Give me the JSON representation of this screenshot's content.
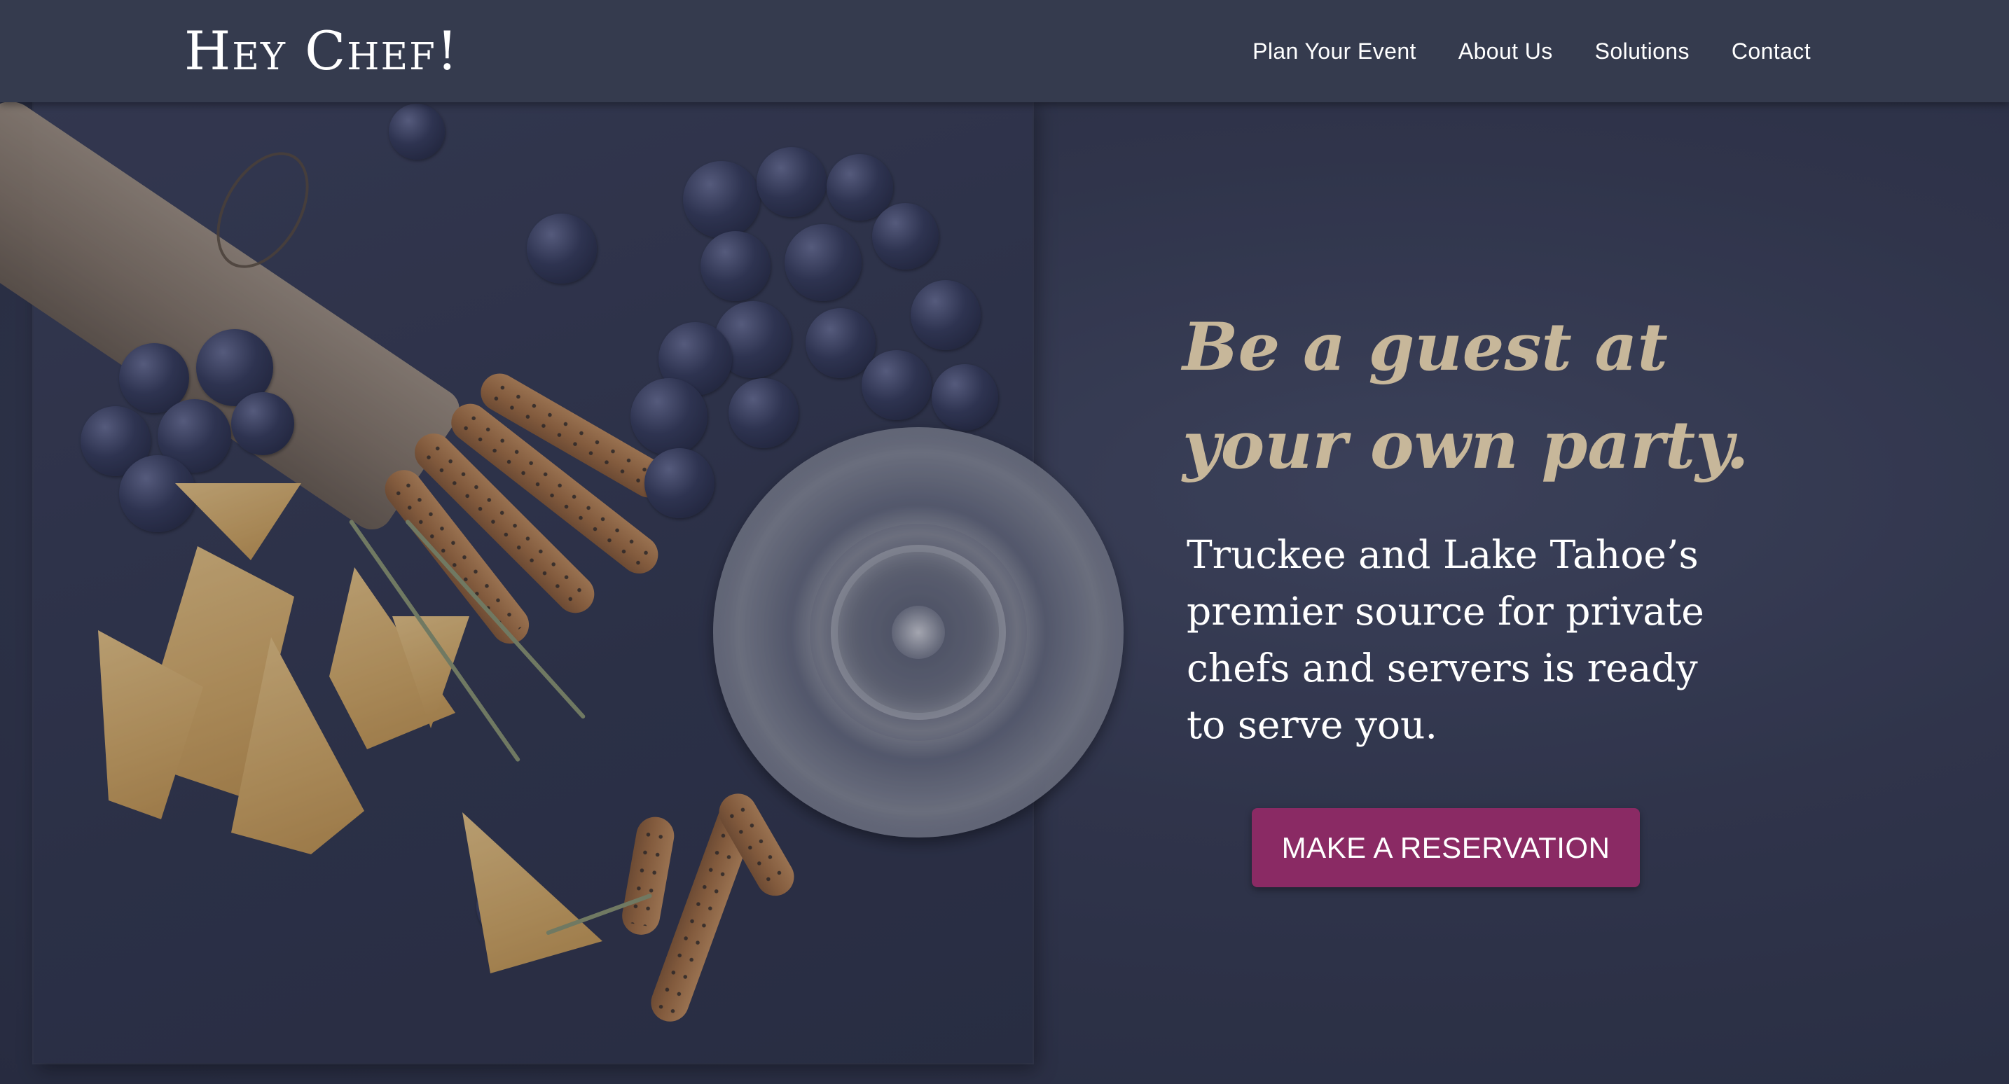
{
  "header": {
    "logo": "Hey Chef!",
    "nav": [
      {
        "label": "Plan Your Event"
      },
      {
        "label": "About Us"
      },
      {
        "label": "Solutions"
      },
      {
        "label": "Contact"
      }
    ]
  },
  "hero": {
    "title_line1": "Be a guest at",
    "title_line2": "your own party.",
    "subtitle": "Truckee and Lake Tahoe’s premier source for private chefs and servers is ready to serve you.",
    "cta_label": "MAKE A RESERVATION"
  },
  "colors": {
    "header_bg": "#353b4e",
    "title_gold": "#c7b79a",
    "cta_bg": "#8a2a64",
    "text_white": "#ffffff"
  }
}
